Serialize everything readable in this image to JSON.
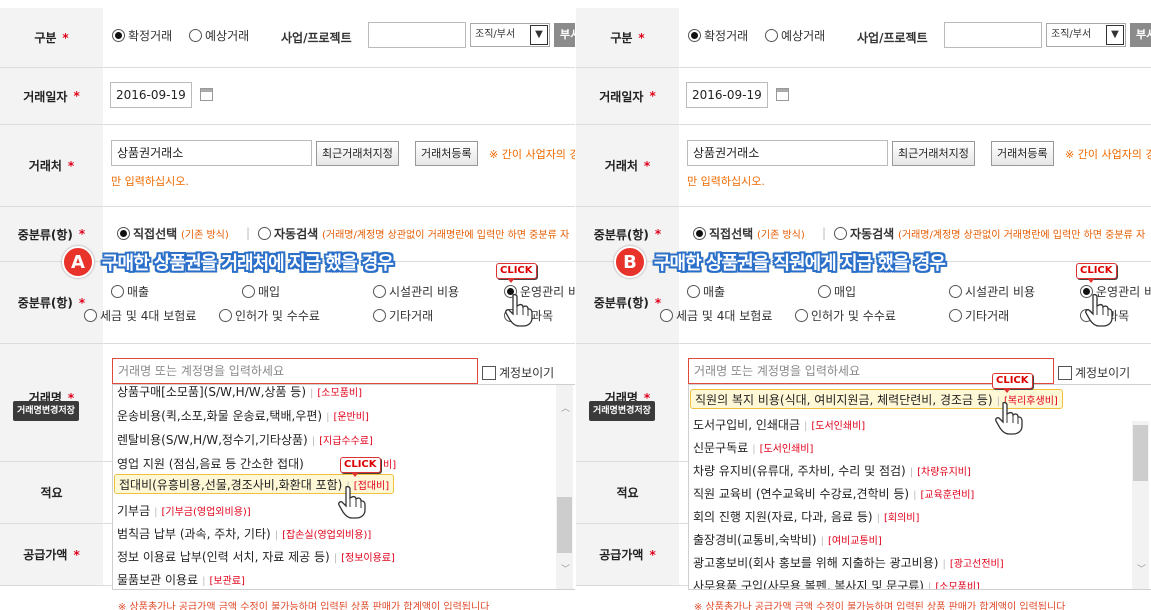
{
  "labels": {
    "category": "구분",
    "project": "사업/프로젝트",
    "trade_date": "거래일자",
    "vendor": "거래처",
    "mid_class": "중분류(항)",
    "trade_name": "거래명",
    "summary": "적요",
    "supply_amount": "공급가액",
    "required_mark": "*"
  },
  "category_options": [
    "확정거래",
    "예상거래"
  ],
  "org_select": "조직/부서",
  "org_button": "부서",
  "date_value": "2016-09-19",
  "vendor_value": "상품권거래소",
  "vendor_buttons": [
    "최근거래처지정",
    "거래처등록"
  ],
  "vendor_note_1": "※ 간이 사업자의 경",
  "vendor_note_2": "만 입력하십시오.",
  "input_mode": {
    "direct": "직접선택",
    "direct_note": "(기존 방식)",
    "auto": "자동검색",
    "auto_note": "(거래명/계정명 상관없이 거래명란에 입력만 하면 중분류 자"
  },
  "mid_options": [
    "매출",
    "매입",
    "시설관리 비용",
    "운영관리 비",
    "세금 및 4대 보험료",
    "인허가 및 수수료",
    "기타거래",
    "정과목"
  ],
  "search_placeholder": "거래명 또는 계정명을 입력하세요",
  "show_account": "계정보이기",
  "change_button": "거래명변경저장",
  "click_label": "CLICK",
  "footnote": "※ 상품총가나 공급가액 금액 수정이 불가능하며 입력된 상품 판매가 합계액이 입력됩니다",
  "panel_a": {
    "badge": "A",
    "banner": "구매한 상품권을 거래처에 지급 했을 경우",
    "items": [
      {
        "text": "상품구매[소모품](S/W,H/W,상품 등)",
        "tag": "[소모품비]"
      },
      {
        "text": "운송비용(퀵,소포,화물 운송료,택배,우편)",
        "tag": "[운반비]"
      },
      {
        "text": "렌탈비용(S/W,H/W,정수기,기타상품)",
        "tag": "[지급수수료]"
      },
      {
        "text": "영업 지원 (점심,음료 등 간소한 접대)",
        "tag": "생비]"
      },
      {
        "text": "접대비(유흥비용,선물,경조사비,화환대 포함)",
        "tag": "[접대비]"
      },
      {
        "text": "기부금",
        "tag": "[기부금(영업외비용)]"
      },
      {
        "text": "범칙금 납부 (과속, 주차, 기타)",
        "tag": "[잡손실(영업외비용)]"
      },
      {
        "text": "정보 이용료 납부(인력 서치, 자료 제공 등)",
        "tag": "[정보이용료]"
      },
      {
        "text": "물품보관 이용료",
        "tag": "[보관료]"
      }
    ]
  },
  "panel_b": {
    "badge": "B",
    "banner": "구매한 상품권을 직원에게 지급 했을 경우",
    "items": [
      {
        "text": "직원의 복지 비용(식대, 여비지원금, 체력단련비, 경조금 등)",
        "tag": "[복리후생비]"
      },
      {
        "text": "도서구입비, 인쇄대금",
        "tag": "[도서인쇄비]"
      },
      {
        "text": "신문구독료",
        "tag": "[도서인쇄비]"
      },
      {
        "text": "차량 유지비(유류대, 주차비, 수리 및 점검)",
        "tag": "[차량유지비]"
      },
      {
        "text": "직원 교육비 (연수교육비 수강료,견학비 등)",
        "tag": "[교육훈련비]"
      },
      {
        "text": "회의 진행 지원(자료, 다과, 음료 등)",
        "tag": "[회의비]"
      },
      {
        "text": "출장경비(교통비,숙박비)",
        "tag": "[여비교통비]"
      },
      {
        "text": "광고홍보비(회사 홍보를 위해 지출하는 광고비용)",
        "tag": "[광고선전비]"
      },
      {
        "text": "사무용품 구입(사무용 볼펜, 복사지 및 문구류)",
        "tag": "[소모품비]"
      }
    ]
  }
}
